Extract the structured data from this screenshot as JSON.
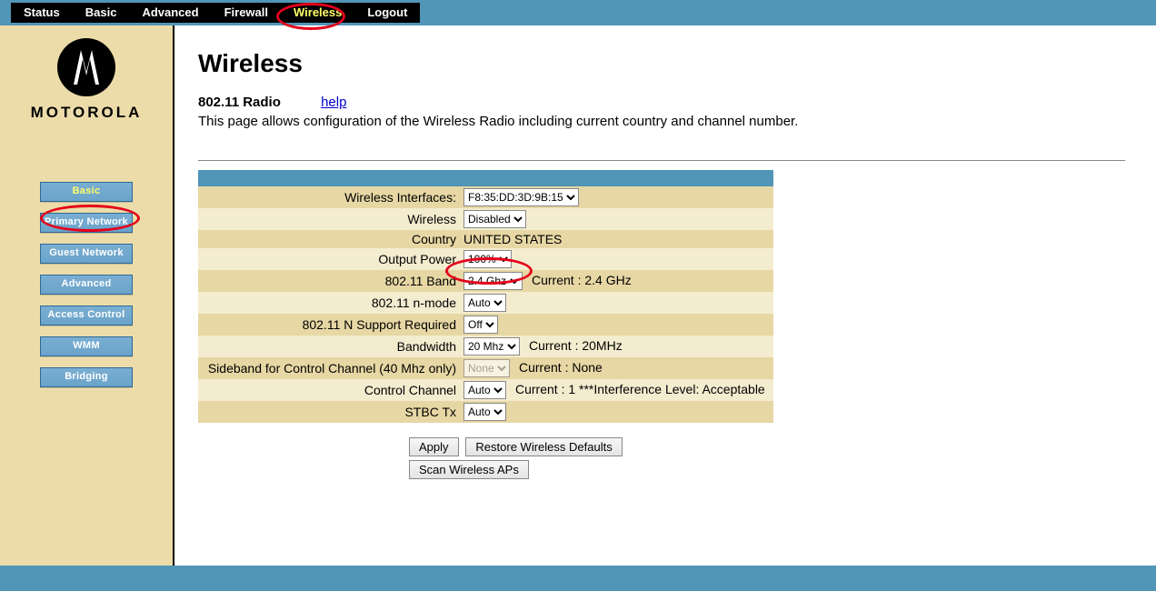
{
  "topnav": {
    "items": [
      "Status",
      "Basic",
      "Advanced",
      "Firewall",
      "Wireless",
      "Logout"
    ],
    "active": "Wireless"
  },
  "brand": "MOTOROLA",
  "sidebar": {
    "items": [
      "Basic",
      "Primary Network",
      "Guest Network",
      "Advanced",
      "Access Control",
      "WMM",
      "Bridging"
    ],
    "active": "Basic"
  },
  "page": {
    "title": "Wireless",
    "section_title": "802.11 Radio",
    "help_label": "help",
    "description": "This page allows configuration of the Wireless Radio including current country and channel number."
  },
  "settings": [
    {
      "label": "Wireless Interfaces:",
      "control": "select",
      "value": "F8:35:DD:3D:9B:15",
      "after": ""
    },
    {
      "label": "Wireless",
      "control": "select",
      "value": "Disabled",
      "after": ""
    },
    {
      "label": "Country",
      "control": "text",
      "value": "UNITED STATES",
      "after": ""
    },
    {
      "label": "Output Power",
      "control": "select",
      "value": "100%",
      "after": ""
    },
    {
      "label": "802.11 Band",
      "control": "select",
      "value": "2.4 Ghz",
      "after": "Current :  2.4 GHz"
    },
    {
      "label": "802.11 n-mode",
      "control": "select",
      "value": "Auto",
      "after": ""
    },
    {
      "label": "802.11 N Support Required",
      "control": "select",
      "value": "Off",
      "after": ""
    },
    {
      "label": "Bandwidth",
      "control": "select",
      "value": "20 Mhz",
      "after": "Current :  20MHz"
    },
    {
      "label": "Sideband for Control Channel (40 Mhz only)",
      "control": "select",
      "value": "None",
      "after": "Current : None",
      "disabled": true
    },
    {
      "label": "Control Channel",
      "control": "select",
      "value": "Auto",
      "after": "Current :   1 ***Interference Level: Acceptable"
    },
    {
      "label": "STBC Tx",
      "control": "select",
      "value": "Auto",
      "after": ""
    }
  ],
  "actions": {
    "apply": "Apply",
    "restore": "Restore Wireless Defaults",
    "scan": "Scan Wireless APs"
  }
}
